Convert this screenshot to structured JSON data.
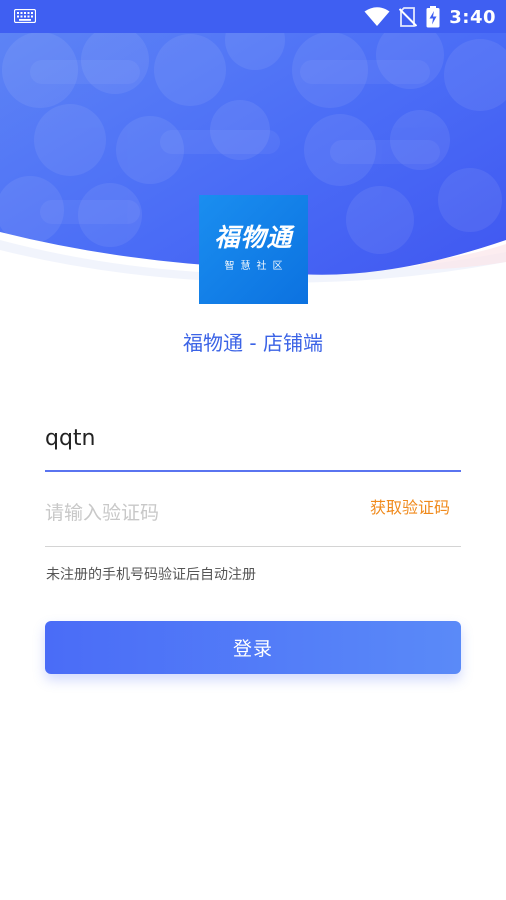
{
  "status_bar": {
    "time": "3:40",
    "icons": [
      "keyboard-icon",
      "wifi-icon",
      "no-sim-icon",
      "battery-charging-icon"
    ]
  },
  "logo": {
    "main_text": "福物通",
    "sub_text": "智慧社区"
  },
  "app_title": "福物通 - 店铺端",
  "form": {
    "phone_value": "qqtn",
    "code_placeholder": "请输入验证码",
    "get_code_label": "获取验证码",
    "hint": "未注册的手机号码验证后自动注册",
    "login_label": "登录"
  },
  "colors": {
    "brand_blue": "#3f5ff2",
    "accent_orange": "#f08a1c",
    "logo_blue": "#1a8ef0"
  }
}
